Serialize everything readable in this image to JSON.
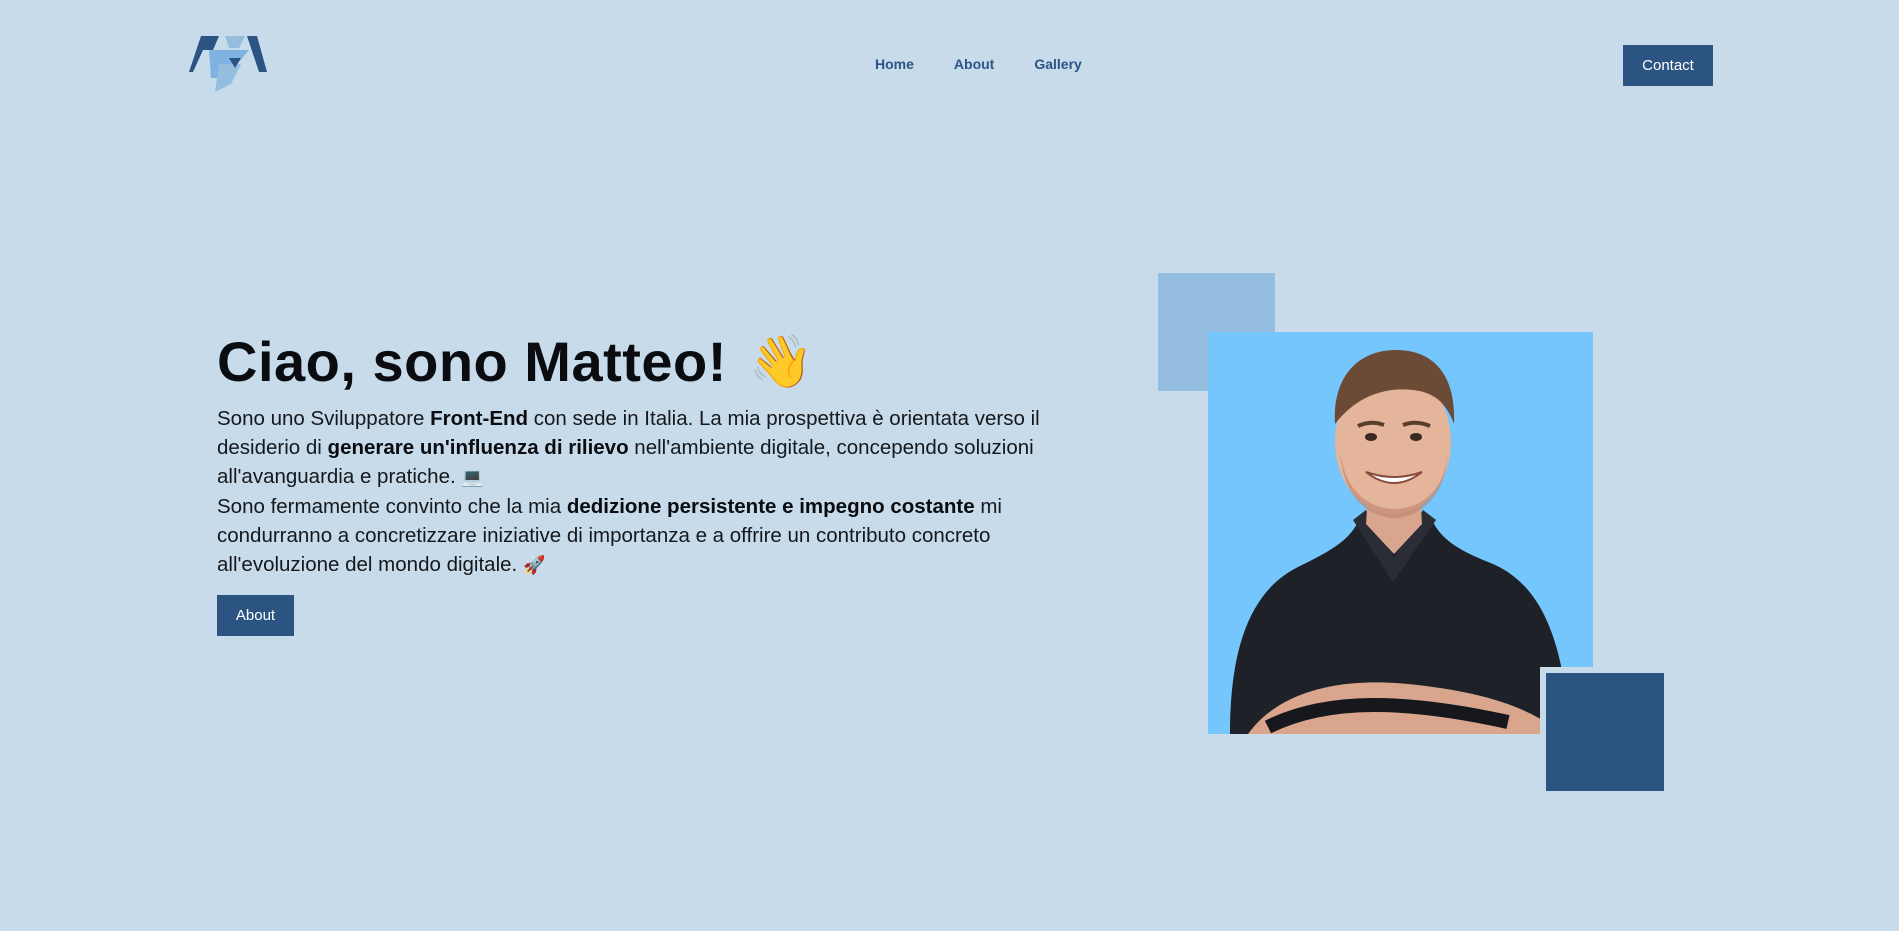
{
  "header": {
    "logo_alt": "MR logo",
    "nav": [
      {
        "label": "Home"
      },
      {
        "label": "About"
      },
      {
        "label": "Gallery"
      }
    ],
    "contact_label": "Contact"
  },
  "hero": {
    "title": "Ciao, sono Matteo!",
    "title_emoji": "👋",
    "p1_a": "Sono uno Sviluppatore ",
    "p1_b": "Front-End",
    "p1_c": " con sede in Italia. La mia prospettiva è orientata verso il desiderio di ",
    "p1_d": "generare un'influenza di rilievo",
    "p1_e": " nell'ambiente digitale, concependo soluzioni all'avanguardia e pratiche.",
    "p1_emoji": "💻",
    "p2_a": "Sono fermamente convinto che la mia ",
    "p2_b": "dedizione persistente e impegno costante",
    "p2_c": " mi condurranno a concretizzare iniziative di importanza e a offrire un contributo concreto all'evoluzione del mondo digitale.",
    "p2_emoji": "🚀",
    "about_label": "About"
  },
  "colors": {
    "background": "#c7dbea",
    "accent": "#2c5482",
    "light_square": "#95bde0",
    "photo_bg": "#74c6fc"
  }
}
